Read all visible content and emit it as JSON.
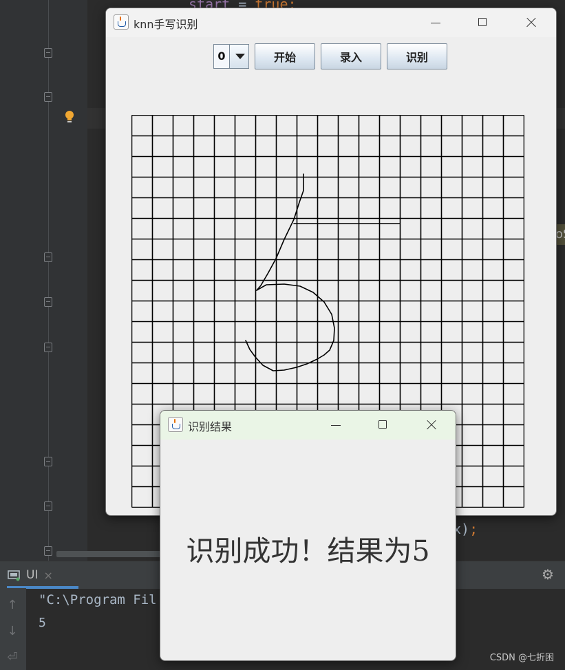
{
  "ide": {
    "code_top_var": "start",
    "code_top_op": " = ",
    "code_top_kw": "true",
    "code_top_semi": ";",
    "code_right_text": "x)",
    "code_right_semi": ";",
    "edge_tag": "oS",
    "bulb_color": "#f0a732"
  },
  "run_panel": {
    "tab_label": "UI",
    "close_glyph": "×",
    "console_lines": [
      "\"C:\\Program Fil",
      "5"
    ],
    "settings_icon": "gear-icon",
    "up_arrow": "↑",
    "down_arrow": "↓",
    "wrap_icon": "⏎"
  },
  "main_window": {
    "title": "knn手写识别",
    "toolbar": {
      "digit_select_value": "0",
      "start_button": "开始",
      "record_button": "录入",
      "recognize_button": "识别"
    },
    "grid": {
      "rows": 19,
      "cols": 19
    }
  },
  "result_dialog": {
    "title": "识别结果",
    "message": "识别成功！结果为5"
  },
  "watermark": "CSDN @七折困",
  "colors": {
    "ide_bg": "#2b2b2b",
    "window_bg": "#eeeeee",
    "grid_line": "#000000",
    "accent_blue": "#4a88c7"
  }
}
